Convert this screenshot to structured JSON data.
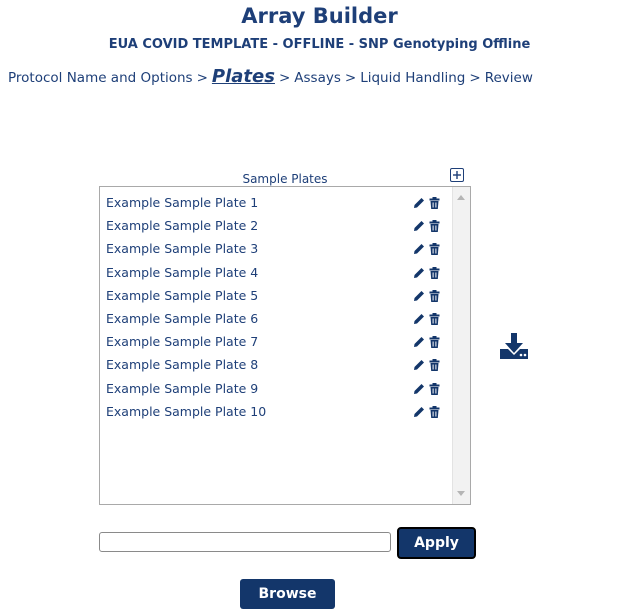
{
  "header": {
    "title": "Array Builder",
    "subtitle": "EUA COVID TEMPLATE - OFFLINE - SNP Genotyping Offline"
  },
  "breadcrumb": {
    "separator": ">",
    "steps": [
      {
        "label": "Protocol Name and Options",
        "active": false
      },
      {
        "label": "Plates",
        "active": true
      },
      {
        "label": "Assays",
        "active": false
      },
      {
        "label": "Liquid Handling",
        "active": false
      },
      {
        "label": "Review",
        "active": false
      }
    ]
  },
  "sample_plates": {
    "header": "Sample Plates",
    "add_icon": "plus-square-icon",
    "edit_icon": "pencil-icon",
    "delete_icon": "trash-icon",
    "items": [
      "Example Sample Plate 1",
      "Example Sample Plate 2",
      "Example Sample Plate 3",
      "Example Sample Plate 4",
      "Example Sample Plate 5",
      "Example Sample Plate 6",
      "Example Sample Plate 7",
      "Example Sample Plate 8",
      "Example Sample Plate 9",
      "Example Sample Plate 10"
    ]
  },
  "download_icon": "download-icon",
  "name_input": {
    "value": "",
    "placeholder": ""
  },
  "apply_label": "Apply",
  "browse_label": "Browse",
  "colors": {
    "primary": "#13366a",
    "text": "#1e3f78"
  }
}
